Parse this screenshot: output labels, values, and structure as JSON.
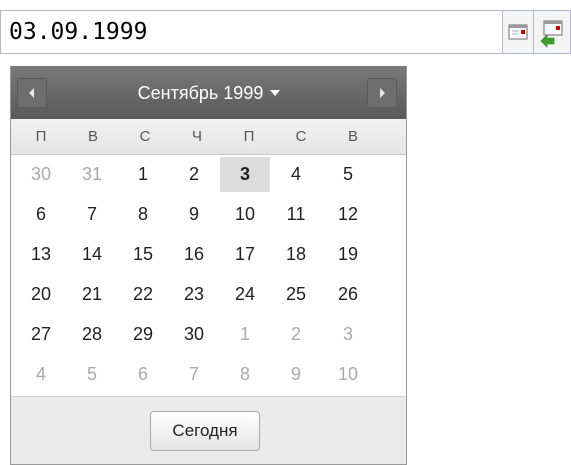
{
  "date_field": {
    "value": "03.09.1999"
  },
  "header": {
    "month_label": "Сентябрь 1999",
    "prev_icon": "chevron-left-icon",
    "next_icon": "chevron-right-icon"
  },
  "weekdays": [
    "П",
    "В",
    "С",
    "Ч",
    "П",
    "С",
    "В"
  ],
  "weeks": [
    [
      {
        "d": "30",
        "other": true
      },
      {
        "d": "31",
        "other": true
      },
      {
        "d": "1"
      },
      {
        "d": "2"
      },
      {
        "d": "3",
        "selected": true
      },
      {
        "d": "4"
      },
      {
        "d": "5"
      }
    ],
    [
      {
        "d": "6"
      },
      {
        "d": "7"
      },
      {
        "d": "8"
      },
      {
        "d": "9"
      },
      {
        "d": "10"
      },
      {
        "d": "11"
      },
      {
        "d": "12"
      }
    ],
    [
      {
        "d": "13"
      },
      {
        "d": "14"
      },
      {
        "d": "15"
      },
      {
        "d": "16"
      },
      {
        "d": "17"
      },
      {
        "d": "18"
      },
      {
        "d": "19"
      }
    ],
    [
      {
        "d": "20"
      },
      {
        "d": "21"
      },
      {
        "d": "22"
      },
      {
        "d": "23"
      },
      {
        "d": "24"
      },
      {
        "d": "25"
      },
      {
        "d": "26"
      }
    ],
    [
      {
        "d": "27"
      },
      {
        "d": "28"
      },
      {
        "d": "29"
      },
      {
        "d": "30"
      },
      {
        "d": "1",
        "other": true
      },
      {
        "d": "2",
        "other": true
      },
      {
        "d": "3",
        "other": true
      }
    ],
    [
      {
        "d": "4",
        "other": true
      },
      {
        "d": "5",
        "other": true
      },
      {
        "d": "6",
        "other": true
      },
      {
        "d": "7",
        "other": true
      },
      {
        "d": "8",
        "other": true
      },
      {
        "d": "9",
        "other": true
      },
      {
        "d": "10",
        "other": true
      }
    ]
  ],
  "footer": {
    "today_label": "Сегодня"
  },
  "colors": {
    "header_bg": "#595959",
    "selected_bg": "#dcdcdc",
    "other_month_text": "#aaaaaa"
  }
}
